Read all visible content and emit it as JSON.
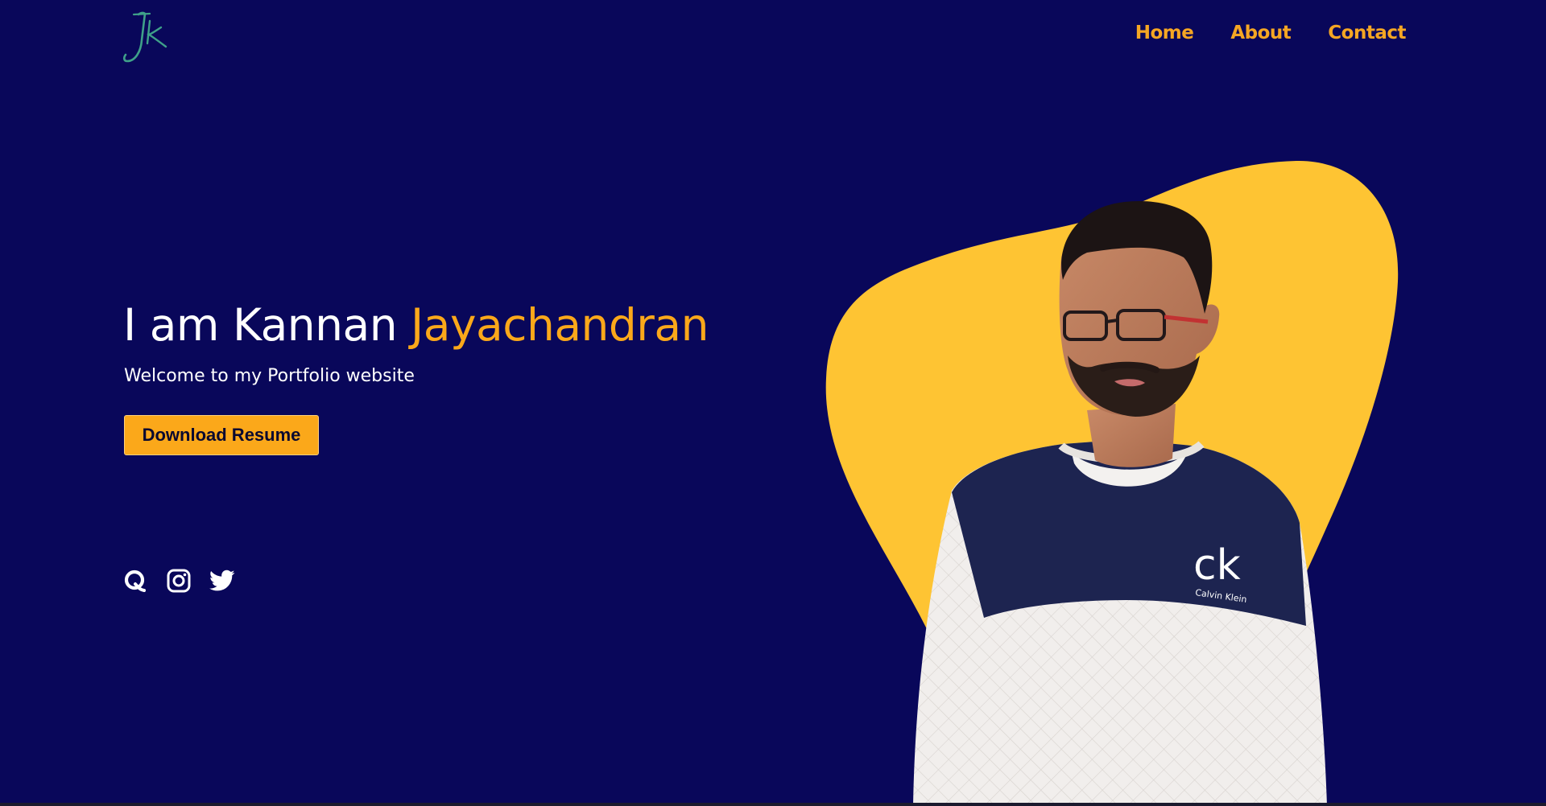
{
  "nav": {
    "links": [
      {
        "label": "Home"
      },
      {
        "label": "About"
      },
      {
        "label": "Contact"
      }
    ]
  },
  "logo": {
    "text": "JK",
    "color": "#3fa089"
  },
  "hero": {
    "title_prefix": "I am Kannan ",
    "title_highlight": "Jayachandran",
    "subtitle": "Welcome to my Portfolio website",
    "button_label": "Download Resume"
  },
  "socials": [
    {
      "icon": "quora-icon"
    },
    {
      "icon": "instagram-icon"
    },
    {
      "icon": "twitter-icon"
    }
  ],
  "photo": {
    "shirt_brand": "ck",
    "shirt_brand_sub": "Calvin Klein"
  },
  "colors": {
    "background": "#09075a",
    "accent": "#fba81a",
    "blob": "#fec433",
    "text": "#ffffff"
  }
}
